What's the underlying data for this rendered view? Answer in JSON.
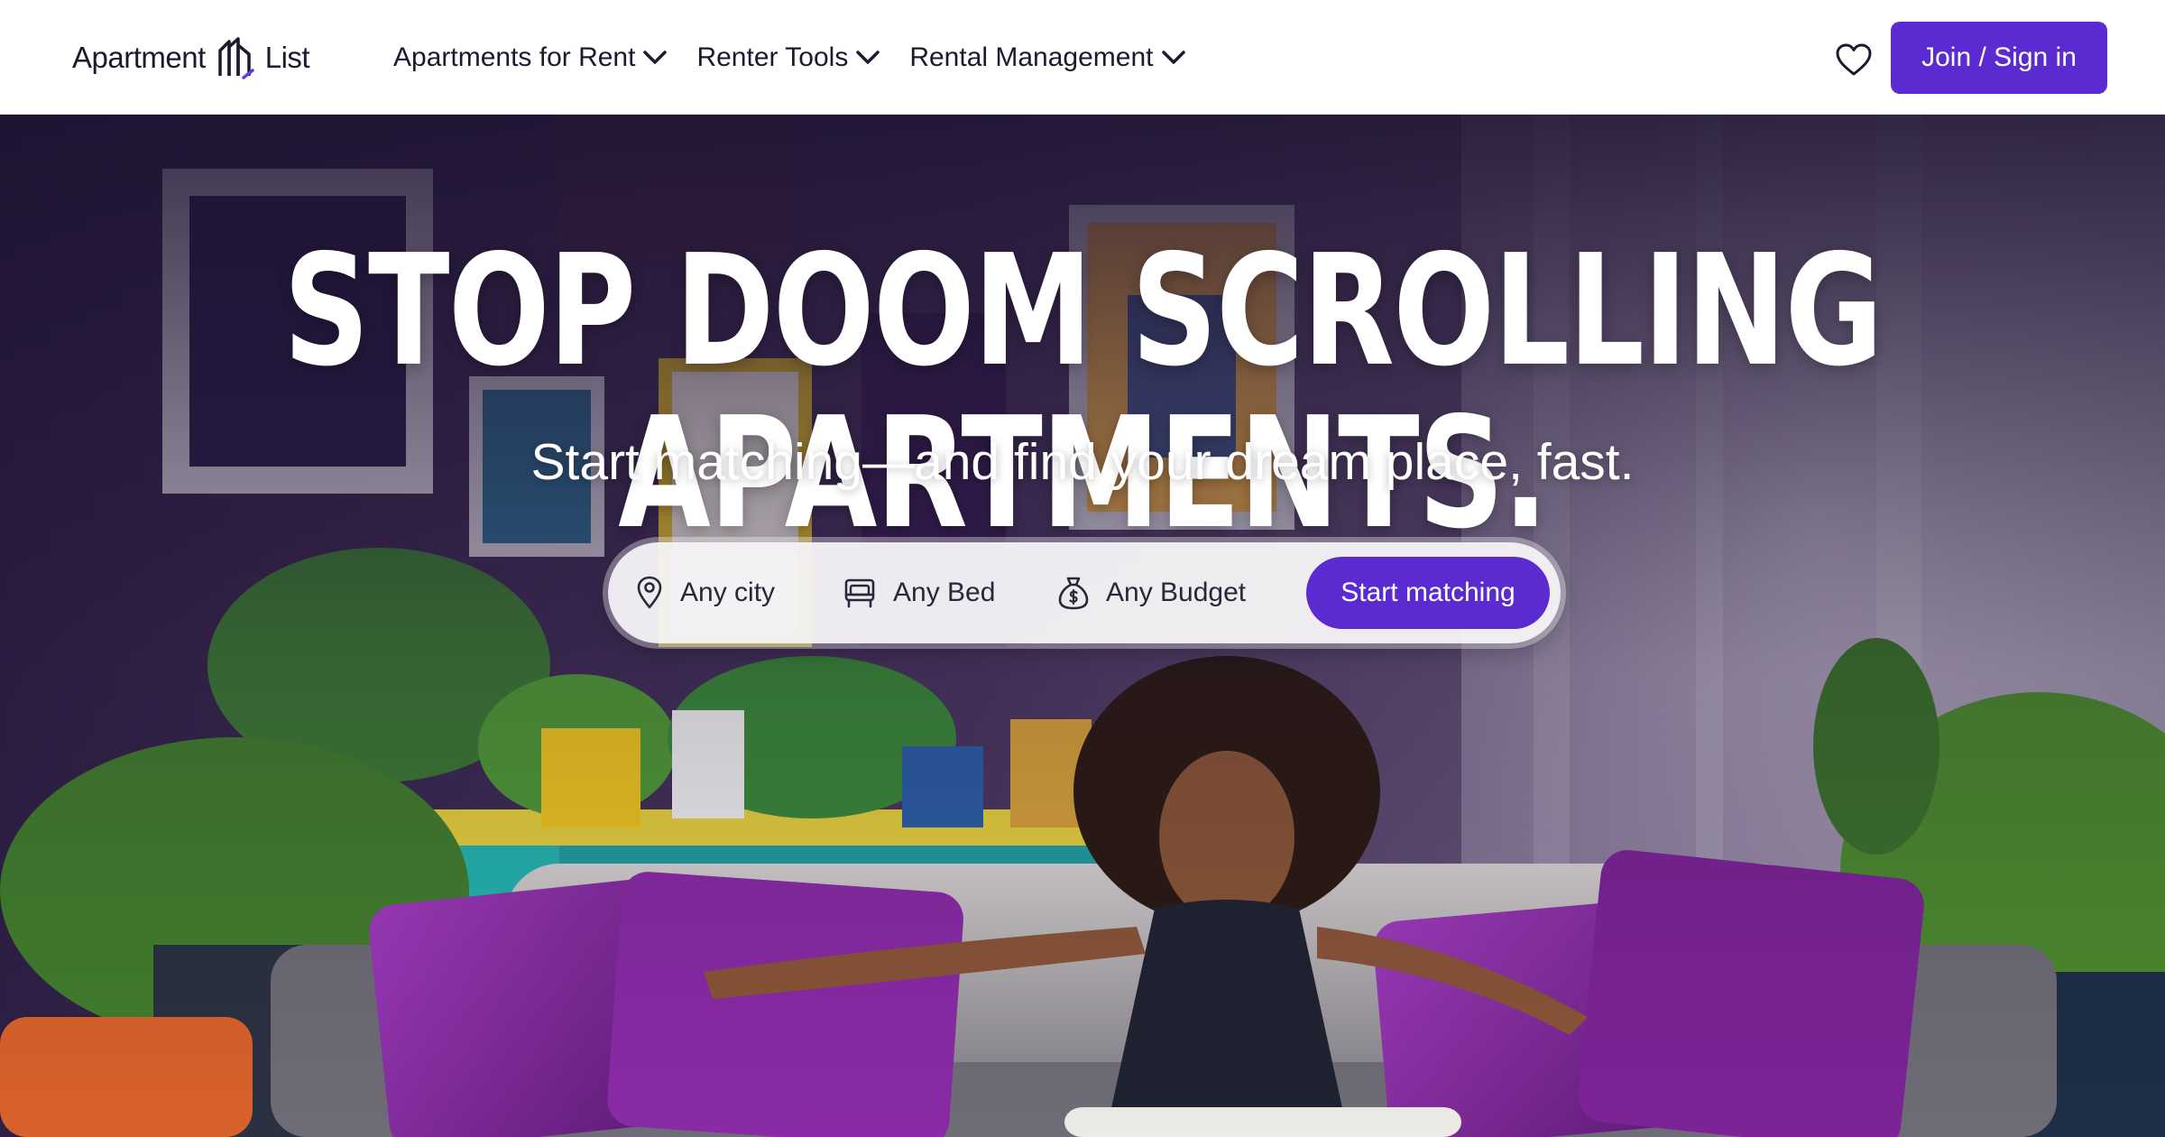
{
  "header": {
    "logo": {
      "word_left": "Apartment",
      "word_right": "List"
    },
    "nav": [
      {
        "label": "Apartments for Rent"
      },
      {
        "label": "Renter Tools"
      },
      {
        "label": "Rental Management"
      }
    ],
    "favorites_icon": "heart-icon",
    "join_label": "Join / Sign in"
  },
  "hero": {
    "headline": "STOP DOOM SCROLLING APARTMENTS.",
    "subheadline": "Start matching—and find your dream place, fast.",
    "search": {
      "city": {
        "label": "Any city",
        "icon": "map-pin-icon"
      },
      "bed": {
        "label": "Any Bed",
        "icon": "bed-icon"
      },
      "budget": {
        "label": "Any Budget",
        "icon": "money-bag-icon"
      },
      "submit_label": "Start matching"
    }
  },
  "colors": {
    "brand_purple": "#5b2bd1",
    "text_dark": "#1c1a2e",
    "white": "#ffffff"
  }
}
